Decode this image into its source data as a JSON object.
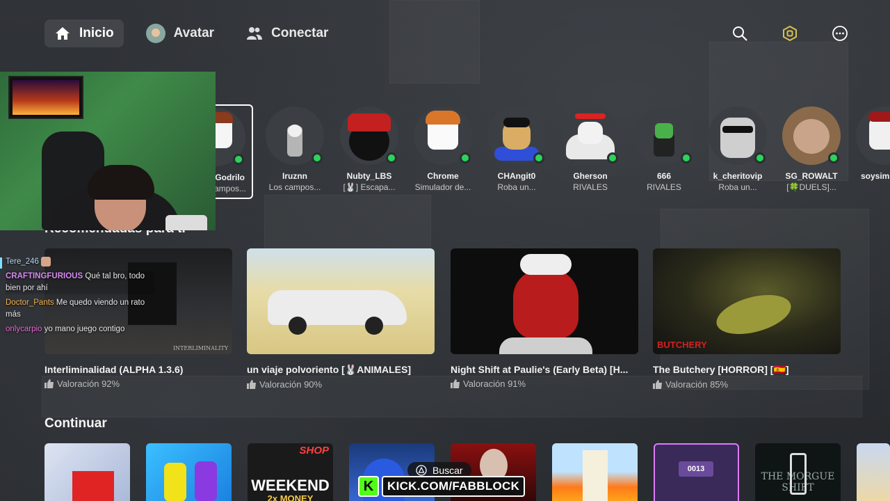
{
  "nav": {
    "items": [
      {
        "label": "Inicio",
        "icon": "home-icon",
        "active": true
      },
      {
        "label": "Avatar",
        "icon": "avatar-icon",
        "active": false
      },
      {
        "label": "Conectar",
        "icon": "people-icon",
        "active": false
      }
    ],
    "right_icons": [
      "search-icon",
      "robux-icon",
      "more-icon"
    ]
  },
  "friends": [
    {
      "name": "Godrilo",
      "game": "Los campos...",
      "selected": true
    },
    {
      "name": "Iruznn",
      "game": "Los campos..."
    },
    {
      "name": "Nubty_LBS",
      "game": "[🐰] Escapa..."
    },
    {
      "name": "Chrome",
      "game": "Simulador de..."
    },
    {
      "name": "CHAngit0",
      "game": "Roba un..."
    },
    {
      "name": "Gherson",
      "game": "RIVALES"
    },
    {
      "name": "666",
      "game": "RIVALES"
    },
    {
      "name": "k_cheritovip",
      "game": "Roba un..."
    },
    {
      "name": "SG_ROWALT",
      "game": "[🍀DUELS]..."
    },
    {
      "name": "soysimi",
      "game": ""
    }
  ],
  "sections": {
    "recommended": "Recomendadas para ti",
    "continue": "Continuar"
  },
  "chat": [
    {
      "user": "Tere_246",
      "text": ""
    },
    {
      "user": "CRAFTINGFURIOUS",
      "text": "Qué tal bro, todo bien por ahí"
    },
    {
      "user": "Doctor_Pants",
      "text": "Me quedo viendo un rato más"
    },
    {
      "user": "onlycarpio",
      "text": "yo mano juego contigo"
    }
  ],
  "games": [
    {
      "title": "Interliminalidad (ALPHA 1.3.6)",
      "rating": "Valoración 92%",
      "thumb_text": "INTERLIMINALITY"
    },
    {
      "title": "un viaje polvoriento [🐰ANIMALES]",
      "rating": "Valoración 90%",
      "thumb_text": ""
    },
    {
      "title": "Night Shift at Paulie's (Early Beta) [H...",
      "rating": "Valoración 91%",
      "thumb_text": ""
    },
    {
      "title": "The Butchery [HORROR] [🇪🇸]",
      "rating": "Valoración 85%",
      "thumb_text": "BUTCHERY"
    }
  ],
  "continue_cards": [
    {
      "label": ""
    },
    {
      "label": ""
    },
    {
      "label": "WEEKEND",
      "sub": "2x MONEY",
      "tag": "SHOP"
    },
    {
      "label": ""
    },
    {
      "label": ""
    },
    {
      "label": ""
    },
    {
      "label": "0013"
    },
    {
      "label": "THE MORGUE SHIFT"
    },
    {
      "label": ""
    }
  ],
  "overlay": {
    "buscar": "Buscar",
    "kick_url": "KICK.COM/FABBLOCK",
    "kick_letter": "K"
  },
  "colors": {
    "online": "#2bd35a",
    "kick_green": "#53fc18",
    "background": "#2b2e32"
  }
}
